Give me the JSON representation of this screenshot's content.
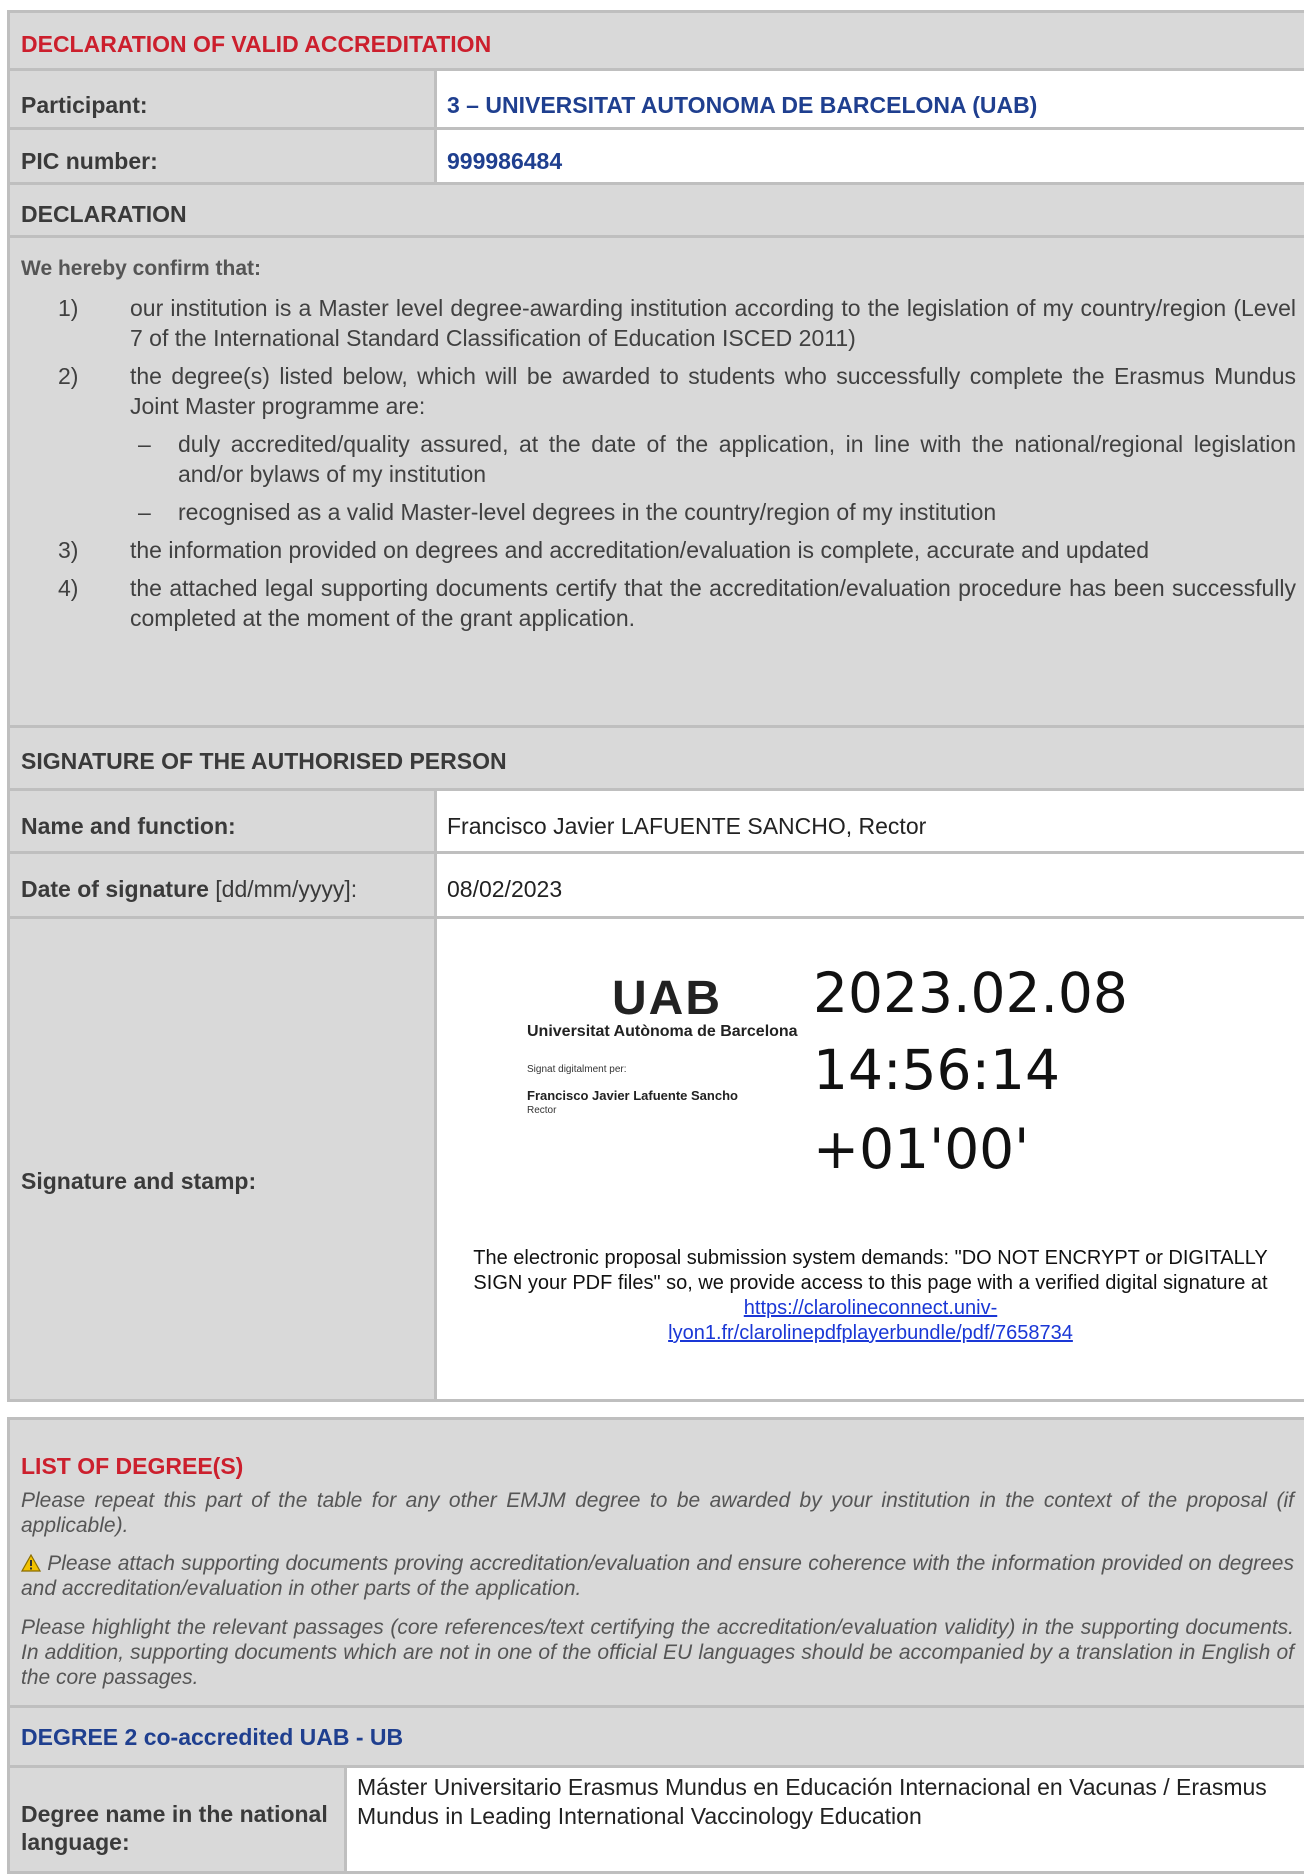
{
  "declaration": {
    "title": "DECLARATION OF VALID ACCREDITATION",
    "participant_label": "Participant:",
    "participant_value": "3 – UNIVERSITAT AUTONOMA DE BARCELONA (UAB)",
    "pic_label": "PIC number:",
    "pic_value": "999986484",
    "section_label": "DECLARATION",
    "intro": "We hereby confirm that:",
    "items": [
      {
        "num": "1)",
        "text": "our institution is a Master level degree-awarding institution according to the legislation of my country/region (Level 7 of the International Standard Classification of Education ISCED 2011)"
      },
      {
        "num": "2)",
        "text": "the degree(s) listed below, which will be awarded to students who successfully complete the Erasmus Mundus Joint Master programme are:"
      },
      {
        "num": "3)",
        "text": "the information provided on degrees and accreditation/evaluation is complete, accurate and updated"
      },
      {
        "num": "4)",
        "text": "the attached legal supporting documents certify that the accreditation/evaluation procedure has been successfully completed at the moment of the grant application."
      }
    ],
    "subitems": [
      {
        "dash": "–",
        "text": "duly accredited/quality assured, at the date of the application, in line with the national/regional legislation and/or bylaws of my institution"
      },
      {
        "dash": "–",
        "text": "recognised as a valid Master-level degrees in the country/region of my institution"
      }
    ]
  },
  "signature": {
    "section_label": "SIGNATURE OF THE AUTHORISED PERSON",
    "name_label": "Name and function:",
    "name_value": "Francisco Javier LAFUENTE SANCHO, Rector",
    "date_label_bold": "Date of signature",
    "date_label_rest": " [dd/mm/yyyy]:",
    "date_value": "08/02/2023",
    "stamp_label": "Signature and stamp:",
    "logo_text": "UAB",
    "university": "Universitat Autònoma de Barcelona",
    "signed_by": "Signat digitalment per:",
    "signer": "Francisco Javier Lafuente Sancho",
    "signer_role": "Rector",
    "stamp_date": "2023.02.08",
    "stamp_time": "14:56:14",
    "stamp_tz": "+01'00'",
    "note": "The electronic proposal submission system demands: \"DO NOT ENCRYPT or DIGITALLY SIGN your PDF files\" so, we provide access to this page with a verified digital signature at",
    "link_line1": "https://clarolineconnect.univ-",
    "link_line2": "lyon1.fr/clarolinepdfplayerbundle/pdf/7658734"
  },
  "degrees": {
    "title": "LIST OF DEGREE(S)",
    "note1": "Please repeat this part of the table for any other EMJM degree to be awarded by your institution in the context of the proposal (if applicable).",
    "warning_icon": "warning-icon",
    "note2": "Please attach supporting documents proving accreditation/evaluation and ensure coherence with the information provided on degrees and accreditation/evaluation in other parts of the application.",
    "note3": "Please highlight the relevant passages (core references/text certifying the accreditation/evaluation validity) in the supporting documents. In addition, supporting documents which are not in one of the official EU languages should be accompanied by a translation in English of the core passages.",
    "degree_title": "DEGREE 2 co-accredited UAB - UB",
    "degree_name_label": "Degree name in the national language:",
    "degree_name_value": "Máster Universitario Erasmus Mundus en Educación Internacional en Vacunas / Erasmus Mundus in Leading International Vaccinology Education"
  }
}
